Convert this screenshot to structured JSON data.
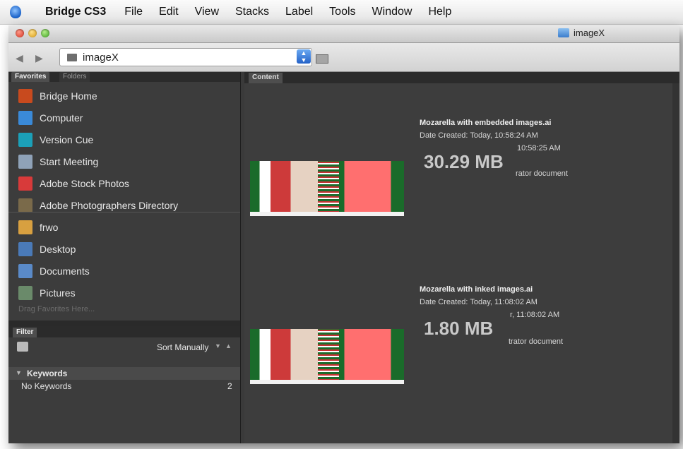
{
  "menubar": {
    "app_name": "Bridge CS3",
    "items": [
      "File",
      "Edit",
      "View",
      "Stacks",
      "Label",
      "Tools",
      "Window",
      "Help"
    ]
  },
  "window": {
    "title": "imageX"
  },
  "toolbar": {
    "path": "imageX"
  },
  "left_panel": {
    "tabs": [
      "Favorites",
      "Folders"
    ],
    "favorites": [
      {
        "label": "Bridge Home",
        "icon": "bridge-home-icon",
        "color": "#c84a1e"
      },
      {
        "label": "Computer",
        "icon": "computer-icon",
        "color": "#3a8ad8"
      },
      {
        "label": "Version Cue",
        "icon": "version-cue-icon",
        "color": "#1ba0b8"
      },
      {
        "label": "Start Meeting",
        "icon": "meeting-icon",
        "color": "#8fa2b8"
      },
      {
        "label": "Adobe Stock Photos",
        "icon": "stock-photos-icon",
        "color": "#d83a3a"
      },
      {
        "label": "Adobe Photographers Directory",
        "icon": "photographers-icon",
        "color": "#7a6a4a"
      }
    ],
    "places": [
      {
        "label": "frwo",
        "icon": "home-icon",
        "color": "#d8a040"
      },
      {
        "label": "Desktop",
        "icon": "desktop-icon",
        "color": "#4a7ab8"
      },
      {
        "label": "Documents",
        "icon": "documents-icon",
        "color": "#5a8ac8"
      },
      {
        "label": "Pictures",
        "icon": "pictures-icon",
        "color": "#6a8a6a"
      }
    ],
    "drag_hint": "Drag Favorites Here..."
  },
  "filter_panel": {
    "tab": "Filter",
    "sort_label": "Sort Manually",
    "keywords_title": "Keywords",
    "no_keywords_label": "No Keywords",
    "no_keywords_count": "2"
  },
  "content": {
    "tab": "Content",
    "items": [
      {
        "name": "Mozarella with embedded images.ai",
        "date_created": "Date Created: Today, 10:58:24 AM",
        "date_modified": "10:58:25 AM",
        "size": "30.29 MB",
        "doc_type": "rator document"
      },
      {
        "name": "Mozarella with inked images.ai",
        "date_created": "Date Created: Today, 11:08:02 AM",
        "date_modified": "r, 11:08:02 AM",
        "size": "1.80 MB",
        "doc_type": "trator document"
      }
    ]
  }
}
